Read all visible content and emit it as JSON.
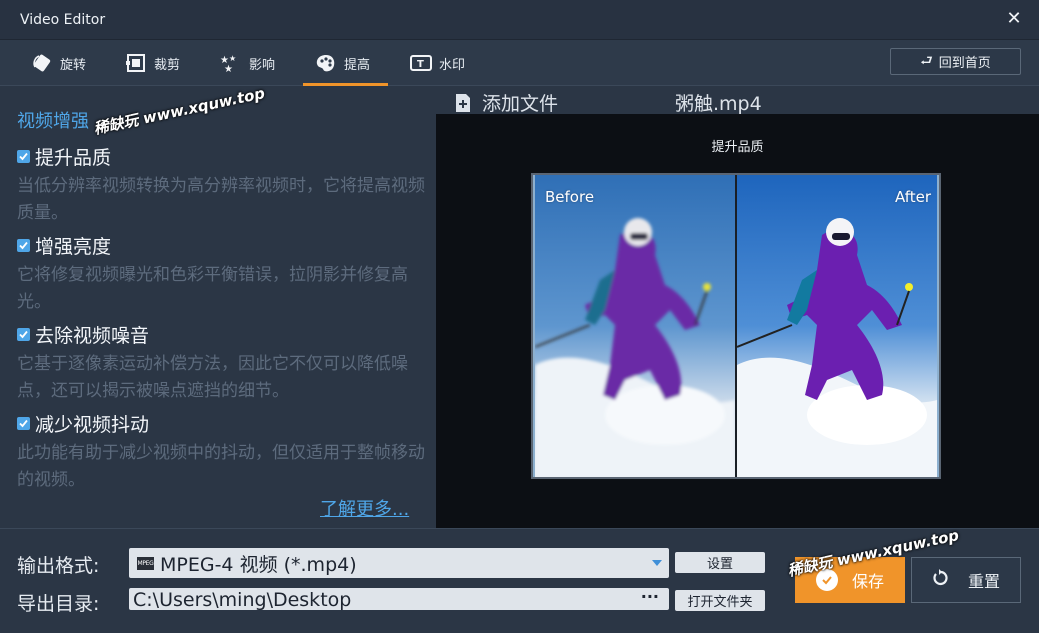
{
  "window": {
    "title": "Video Editor",
    "close_glyph": "✕"
  },
  "tabs": [
    {
      "label": "旋转",
      "icon": "rotate-icon",
      "active": false
    },
    {
      "label": "裁剪",
      "icon": "crop-icon",
      "active": false
    },
    {
      "label": "影响",
      "icon": "effects-icon",
      "active": false
    },
    {
      "label": "提高",
      "icon": "palette-icon",
      "active": true
    },
    {
      "label": "水印",
      "icon": "watermark-icon",
      "active": false
    }
  ],
  "home_button": {
    "label": "回到首页",
    "icon": "return-icon"
  },
  "left": {
    "section_title": "视频增强",
    "options": [
      {
        "label": "提升品质",
        "checked": true,
        "desc": "当低分辨率视频转换为高分辨率视频时，它将提高视频质量。"
      },
      {
        "label": "增强亮度",
        "checked": true,
        "desc": "它将修复视频曝光和色彩平衡错误，拉阴影并修复高光。"
      },
      {
        "label": "去除视频噪音",
        "checked": true,
        "desc": "它基于逐像素运动补偿方法，因此它不仅可以降低噪点，还可以揭示被噪点遮挡的细节。"
      },
      {
        "label": "减少视频抖动",
        "checked": true,
        "desc": "此功能有助于减少视频中的抖动，但仅适用于整帧移动的视频。"
      }
    ],
    "learn_more": "了解更多..."
  },
  "preview": {
    "add_file": "添加文件",
    "filename": "粥触.mp4",
    "caption": "提升品质",
    "before_label": "Before",
    "after_label": "After"
  },
  "bottom": {
    "format_label": "输出格式:",
    "format_value": "MPEG-4 视频 (*.mp4)",
    "format_icon_text": "MPEG",
    "settings_button": "设置",
    "dir_label": "导出目录:",
    "dir_value": "C:\\Users\\ming\\Desktop",
    "browse_glyph": "···",
    "open_folder_button": "打开文件夹",
    "save_button": "保存",
    "reset_button": "重置"
  },
  "watermarks": [
    "稀缺玩 www.xquw.top",
    "稀缺玩 www.xquw.top"
  ],
  "colors": {
    "accent": "#f0942a",
    "link": "#4fa6e8",
    "background": "#2b3645",
    "preview_bg": "#0c0f14"
  }
}
